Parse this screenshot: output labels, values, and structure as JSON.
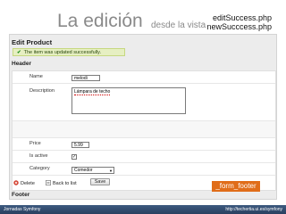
{
  "slide": {
    "title": "La edición",
    "subtitle": "desde la vista",
    "files": [
      "editSuccess.php",
      "newSucccess.php"
    ]
  },
  "panel": {
    "title": "Edit Product",
    "notice": "The item was updated successfully.",
    "header_label": "Header",
    "footer_label": "Footer",
    "partial_tag": "_form_footer"
  },
  "form": {
    "name": {
      "label": "Name",
      "value": "melodi"
    },
    "description": {
      "label": "Description",
      "value": "Lámpara de techo"
    },
    "price": {
      "label": "Price",
      "value": "5.99"
    },
    "is_active": {
      "label": "Is active",
      "checked": true
    },
    "category": {
      "label": "Category",
      "selected": "Comedor"
    }
  },
  "actions": {
    "delete_label": "Delete",
    "back_label": "Back to list",
    "save_label": "Save"
  },
  "footer": {
    "left": "Jornadas Symfony",
    "right": "http://techertia.ui.es/symfony"
  },
  "colors": {
    "accent_orange": "#e06d1a",
    "notice_bg": "#e6efc2",
    "footer_bar": "#3d5a80"
  }
}
